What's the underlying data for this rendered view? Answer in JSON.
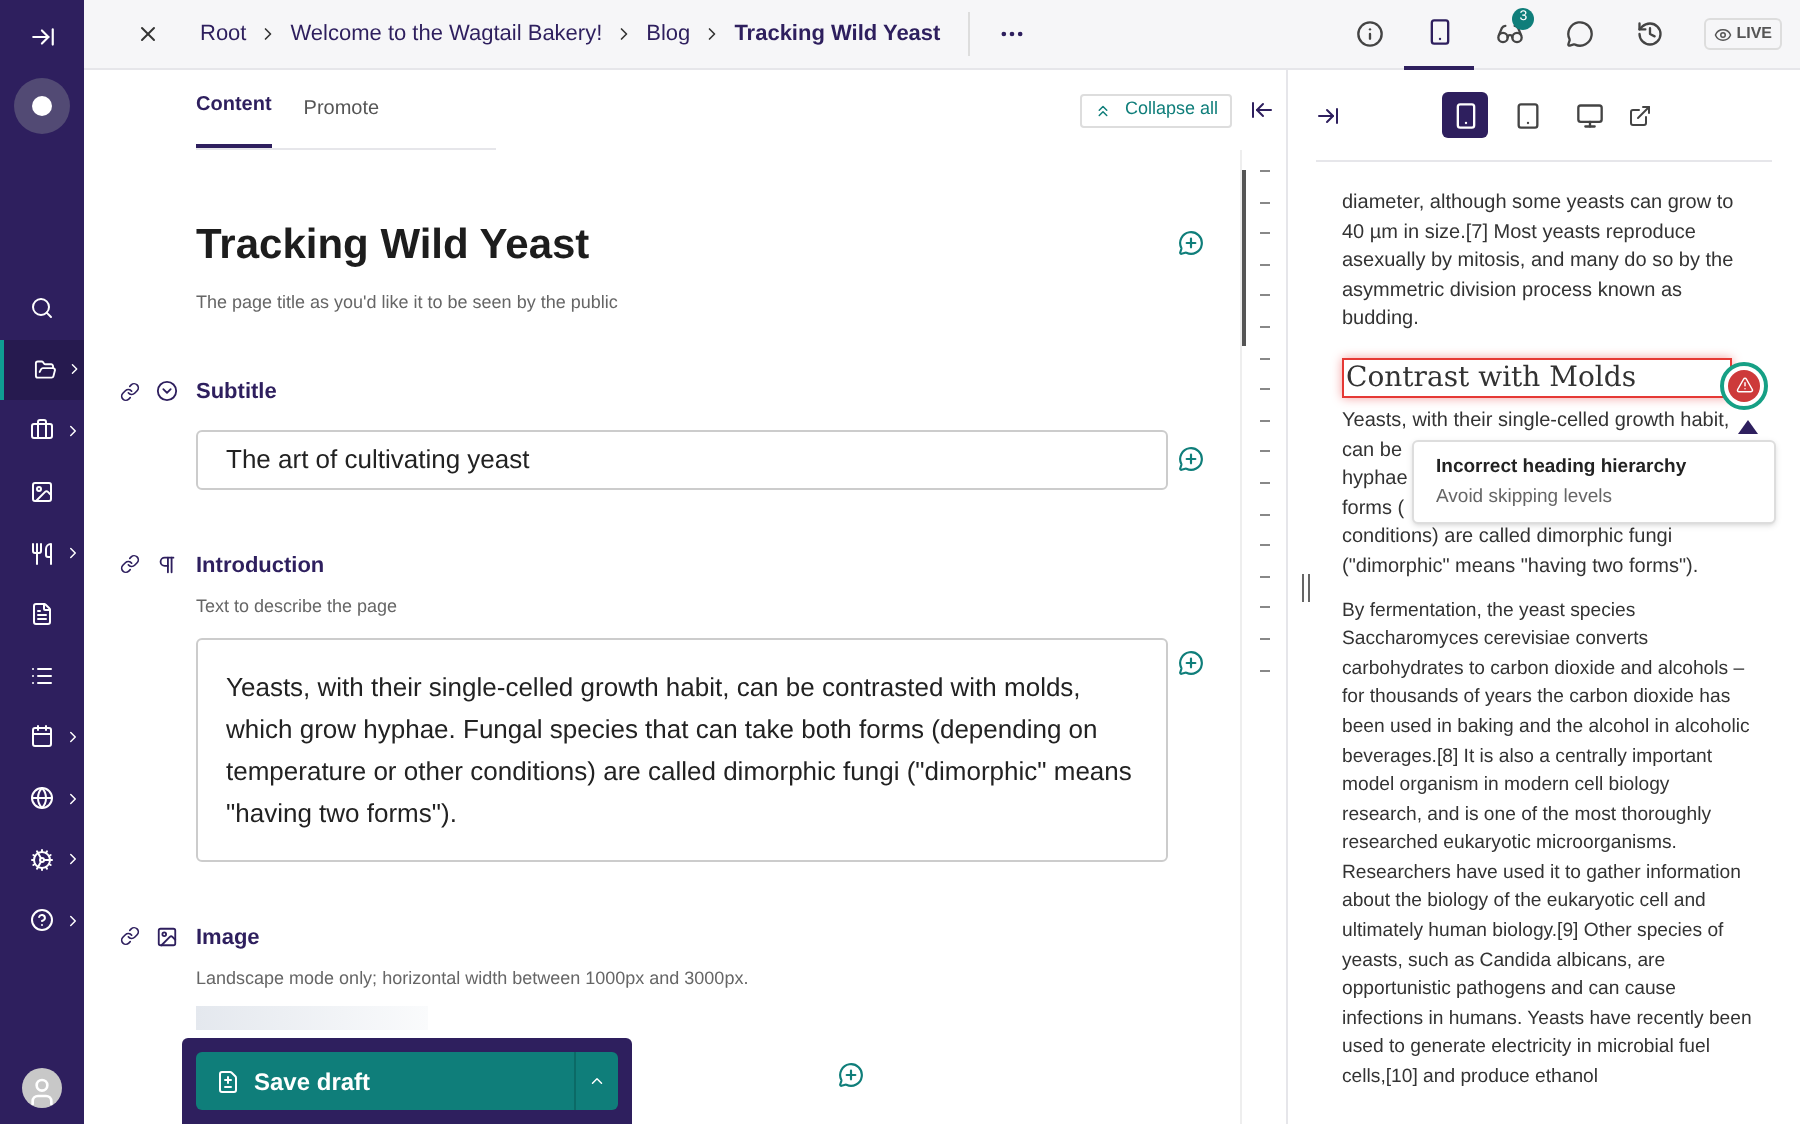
{
  "sidebar": {
    "items": [
      {
        "selected": false,
        "expandable": false
      },
      {
        "selected": true,
        "expandable": true
      },
      {
        "selected": false,
        "expandable": true
      },
      {
        "selected": false,
        "expandable": false
      },
      {
        "selected": false,
        "expandable": true
      },
      {
        "selected": false,
        "expandable": false
      },
      {
        "selected": false,
        "expandable": false
      },
      {
        "selected": false,
        "expandable": true
      },
      {
        "selected": false,
        "expandable": true
      },
      {
        "selected": false,
        "expandable": true
      },
      {
        "selected": false,
        "expandable": true
      }
    ]
  },
  "breadcrumbs": [
    "Root",
    "Welcome to the Wagtail Bakery!",
    "Blog",
    "Tracking Wild Yeast"
  ],
  "toolbar": {
    "items": [
      {
        "selected": false
      },
      {
        "selected": true
      },
      {
        "selected": false,
        "badge": "3"
      },
      {
        "selected": false
      },
      {
        "selected": false
      }
    ],
    "live_label": "LIVE"
  },
  "tabs": [
    {
      "label": "Content",
      "selected": true
    },
    {
      "label": "Promote",
      "selected": false
    }
  ],
  "collapse_all": "Collapse all",
  "title": {
    "value": "Tracking Wild Yeast",
    "help": "The page title as you'd like it to be seen by the public"
  },
  "fields": [
    {
      "kind": "input",
      "label": "Subtitle",
      "value": "The art of cultivating yeast"
    },
    {
      "kind": "textarea",
      "label": "Introduction",
      "help": "Text to describe the page",
      "value": "Yeasts, with their single-celled growth habit, can be contrasted with molds, which grow hyphae. Fungal species that can take both forms (depending on temperature or other conditions) are called dimorphic fungi (\"dimorphic\" means \"having two forms\")."
    },
    {
      "kind": "image",
      "label": "Image",
      "help": "Landscape mode only; horizontal width between 1000px and 3000px."
    }
  ],
  "save_button": "Save draft",
  "preview": {
    "devices": [
      {
        "selected": true
      },
      {
        "selected": false
      },
      {
        "selected": false
      }
    ],
    "paragraph_1": "diameter, although some yeasts can grow to 40 µm in size.[7] Most yeasts reproduce asexually by mitosis, and many do so by the asymmetric division process known as budding.",
    "heading": "Contrast with Molds",
    "paragraph_2_lines": [
      "Yeasts, with their single-celled growth habit,",
      "can be",
      "hyphae",
      "forms (",
      "conditions) are called dimorphic fungi",
      "(\"dimorphic\" means \"having two forms\")."
    ],
    "paragraph_3": "By fermentation, the yeast species Saccharomyces cerevisiae converts carbohydrates to carbon dioxide and alcohols – for thousands of years the carbon dioxide has been used in baking and the alcohol in alcoholic beverages.[8] It is also a centrally important model organism in modern cell biology research, and is one of the most thoroughly researched eukaryotic microorganisms. Researchers have used it to gather information about the biology of the eukaryotic cell and ultimately human biology.[9] Other species of yeasts, such as Candida albicans, are opportunistic pathogens and can cause infections in humans. Yeasts have recently been used to generate electricity in microbial fuel cells,[10] and produce ethanol",
    "issue": {
      "title": "Incorrect heading hierarchy",
      "detail": "Avoid skipping levels"
    }
  }
}
